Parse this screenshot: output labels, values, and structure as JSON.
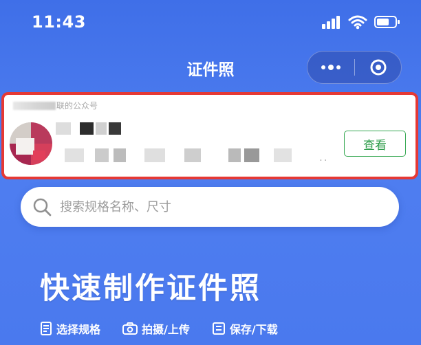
{
  "status_bar": {
    "time": "11:43",
    "icons": [
      "signal-icon",
      "wifi-icon",
      "battery-icon"
    ]
  },
  "nav": {
    "title": "证件照",
    "capsule": {
      "more_icon": "more-icon",
      "close_icon": "target-icon"
    }
  },
  "official_account_card": {
    "label_suffix": "联的公众号",
    "button_label": "查看",
    "ellipsis": ".."
  },
  "search": {
    "placeholder": "搜索规格名称、尺寸",
    "icon": "search-icon"
  },
  "hero": {
    "title": "快速制作证件照"
  },
  "features": [
    {
      "label": "选择规格",
      "icon": "document-icon"
    },
    {
      "label": "拍摄/上传",
      "icon": "camera-icon"
    },
    {
      "label": "保存/下载",
      "icon": "save-icon"
    }
  ],
  "colors": {
    "background": "#3f6fe8",
    "highlight_border": "#e53935",
    "action_green": "#2b9b48",
    "text_white": "#ffffff"
  }
}
